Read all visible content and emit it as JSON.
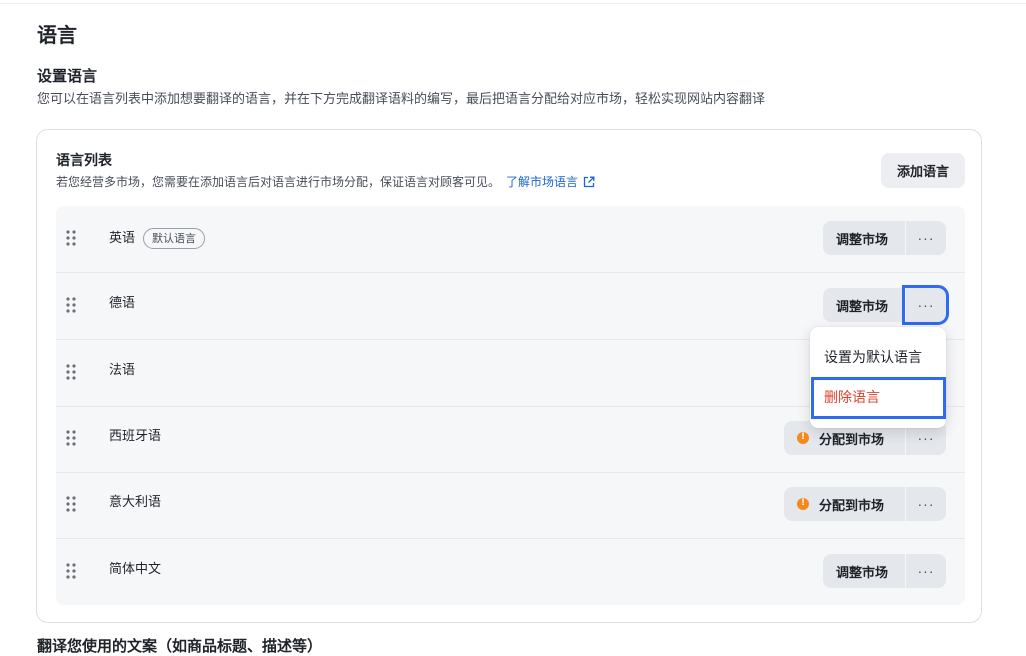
{
  "page": {
    "title": "语言",
    "next_section": "翻译您使用的文案（如商品标题、描述等）"
  },
  "settings": {
    "title": "设置语言",
    "description": "您可以在语言列表中添加想要翻译的语言，并在下方完成翻译语料的编写，最后把语言分配给对应市场，轻松实现网站内容翻译"
  },
  "card": {
    "title": "语言列表",
    "description": "若您经营多市场，您需要在添加语言后对语言进行市场分配，保证语言对顾客可见。",
    "link_label": "了解市场语言",
    "add_button": "添加语言"
  },
  "languages": [
    {
      "name": "英语",
      "badge": "默认语言",
      "action": "调整市场",
      "warning": false,
      "more": "···"
    },
    {
      "name": "德语",
      "badge": null,
      "action": "调整市场",
      "warning": false,
      "more": "···"
    },
    {
      "name": "法语",
      "badge": null,
      "action": "",
      "warning": false,
      "more": ""
    },
    {
      "name": "西班牙语",
      "badge": null,
      "action": "分配到市场",
      "warning": true,
      "more": "···"
    },
    {
      "name": "意大利语",
      "badge": null,
      "action": "分配到市场",
      "warning": true,
      "more": "···"
    },
    {
      "name": "简体中文",
      "badge": null,
      "action": "调整市场",
      "warning": false,
      "more": "···"
    }
  ],
  "menu": {
    "set_default": "设置为默认语言",
    "delete": "删除语言"
  },
  "colors": {
    "link": "#1966d2",
    "danger": "#e0402c",
    "warning": "#f48a1c",
    "focus": "#2f6af2"
  }
}
